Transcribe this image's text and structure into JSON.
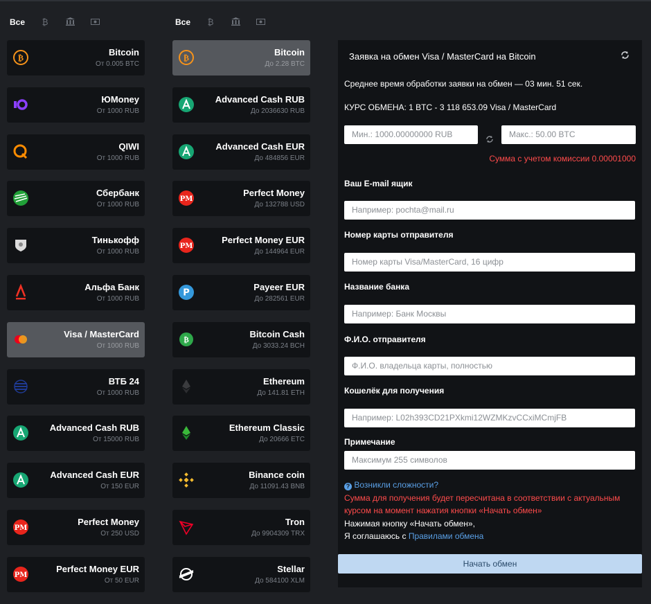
{
  "filters": {
    "all": "Все",
    "icons": [
      "₿",
      "🏛",
      "💵"
    ]
  },
  "left": [
    {
      "name": "Bitcoin",
      "sub": "От 0.005 BTC",
      "icon": "bitcoin-icon",
      "color": "#f7931a"
    },
    {
      "name": "ЮMoney",
      "sub": "От 1000 RUB",
      "icon": "yumoney-icon",
      "color": "#8b3ffd"
    },
    {
      "name": "QIWI",
      "sub": "От 1000 RUB",
      "icon": "qiwi-icon",
      "color": "#ff8c00"
    },
    {
      "name": "Сбербанк",
      "sub": "От 1000 RUB",
      "icon": "sberbank-icon",
      "color": "#21a038"
    },
    {
      "name": "Тинькофф",
      "sub": "От 1000 RUB",
      "icon": "tinkoff-icon",
      "color": "#ffdd2d"
    },
    {
      "name": "Альфа Банк",
      "sub": "От 1000 RUB",
      "icon": "alfabank-icon",
      "color": "#ef3124"
    },
    {
      "name": "Visa / MasterCard",
      "sub": "От 1000 RUB",
      "icon": "mastercard-icon",
      "color": "#eb001b",
      "active": true
    },
    {
      "name": "ВТБ 24",
      "sub": "От 1000 RUB",
      "icon": "vtb-icon",
      "color": "#1f3a93"
    },
    {
      "name": "Advanced Cash RUB",
      "sub": "От 15000 RUB",
      "icon": "advcash-icon",
      "color": "#17a673"
    },
    {
      "name": "Advanced Cash EUR",
      "sub": "От 150 EUR",
      "icon": "advcash-icon",
      "color": "#17a673"
    },
    {
      "name": "Perfect Money",
      "sub": "От 250 USD",
      "icon": "perfectmoney-icon",
      "color": "#e8251c"
    },
    {
      "name": "Perfect Money EUR",
      "sub": "От 50 EUR",
      "icon": "perfectmoney-icon",
      "color": "#e8251c"
    }
  ],
  "right": [
    {
      "name": "Bitcoin",
      "sub": "До 2.28 BTC",
      "icon": "bitcoin-icon",
      "color": "#f7931a",
      "active": true
    },
    {
      "name": "Advanced Cash RUB",
      "sub": "До 2036630 RUB",
      "icon": "advcash-icon",
      "color": "#17a673"
    },
    {
      "name": "Advanced Cash EUR",
      "sub": "До 484856 EUR",
      "icon": "advcash-icon",
      "color": "#17a673"
    },
    {
      "name": "Perfect Money",
      "sub": "До 132788 USD",
      "icon": "perfectmoney-icon",
      "color": "#e8251c"
    },
    {
      "name": "Perfect Money EUR",
      "sub": "До 144964 EUR",
      "icon": "perfectmoney-icon",
      "color": "#e8251c"
    },
    {
      "name": "Payeer EUR",
      "sub": "До 282561 EUR",
      "icon": "payeer-icon",
      "color": "#3498db"
    },
    {
      "name": "Bitcoin Cash",
      "sub": "До 3033.24 BCH",
      "icon": "bitcoin-cash-icon",
      "color": "#2ea84a"
    },
    {
      "name": "Ethereum",
      "sub": "До 141.81 ETH",
      "icon": "ethereum-icon",
      "color": "#3c3c3d"
    },
    {
      "name": "Ethereum Classic",
      "sub": "До 20666 ETC",
      "icon": "ethereum-classic-icon",
      "color": "#3ab83a"
    },
    {
      "name": "Binance coin",
      "sub": "До 11091.43 BNB",
      "icon": "binance-icon",
      "color": "#f3ba2f"
    },
    {
      "name": "Tron",
      "sub": "До 9904309 TRX",
      "icon": "tron-icon",
      "color": "#ef0027"
    },
    {
      "name": "Stellar",
      "sub": "До 584100 XLM",
      "icon": "stellar-icon",
      "color": "#ffffff"
    }
  ],
  "panel": {
    "title": "Заявка на обмен Visa / MasterCard на Bitcoin",
    "avg_time": "Среднее время обработки заявки на обмен — 03 мин. 51 сек.",
    "rate": "КУРС ОБМЕНА: 1 BTC - 3 118 653.09 Visa / MasterCard",
    "min_placeholder": "Мин.: 1000.00000000 RUB",
    "max_placeholder": "Макс.: 50.00 BTC",
    "commission": "Сумма с учетом комиссии 0.00001000",
    "email_label": "Ваш E-mail ящик",
    "email_placeholder": "Например: pochta@mail.ru",
    "card_label": "Номер карты отправителя",
    "card_placeholder": "Номер карты Visa/MasterCard, 16 цифр",
    "bank_label": "Название банка",
    "bank_placeholder": "Например: Банк Москвы",
    "fio_label": "Ф.И.О. отправителя",
    "fio_placeholder": "Ф.И.О. владельца карты, полностью",
    "wallet_label": "Кошелёк для получения",
    "wallet_placeholder": "Например: L02h393CD21PXkmi12WZMKzvCCxiMCmjFB",
    "note_label": "Примечание",
    "note_placeholder": "Максимум 255 символов",
    "help_link": "Возникли сложности?",
    "warning_line1": "Сумма для получения будет пересчитана в соответствии с актуальным",
    "warning_line2": "курсом на момент нажатия кнопки «Начать обмен»",
    "agree_line1": "Нажимая кнопку «Начать обмен»,",
    "agree_prefix": "Я соглашаюсь с ",
    "agree_link": "Правилами обмена",
    "submit": "Начать обмен"
  }
}
